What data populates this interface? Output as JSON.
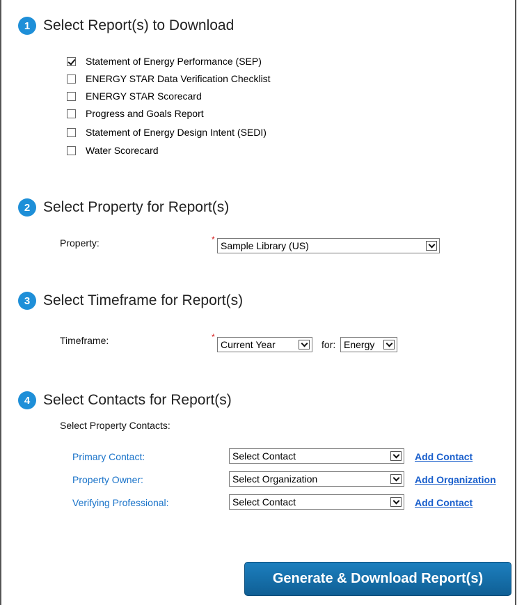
{
  "step1": {
    "number": "1",
    "title": "Select Report(s) to Download",
    "reports": [
      {
        "label": "Statement of Energy Performance (SEP)",
        "checked": true
      },
      {
        "label": "ENERGY STAR Data Verification Checklist",
        "checked": false
      },
      {
        "label": "ENERGY STAR Scorecard",
        "checked": false
      },
      {
        "label": "Progress and Goals Report",
        "checked": false
      },
      {
        "label": "Statement of Energy Design Intent (SEDI)",
        "checked": false
      },
      {
        "label": "Water Scorecard",
        "checked": false
      }
    ]
  },
  "step2": {
    "number": "2",
    "title": "Select Property for Report(s)",
    "property_label": "Property:",
    "required_mark": "*",
    "property_value": "Sample Library (US)"
  },
  "step3": {
    "number": "3",
    "title": "Select Timeframe for Report(s)",
    "timeframe_label": "Timeframe:",
    "required_mark": "*",
    "timeframe_value": "Current Year",
    "for_label": "for:",
    "for_value": "Energy"
  },
  "step4": {
    "number": "4",
    "title": "Select Contacts for Report(s)",
    "subtitle": "Select Property Contacts:",
    "contacts": [
      {
        "label": "Primary Contact:",
        "value": "Select Contact",
        "link": "Add Contact"
      },
      {
        "label": "Property Owner:",
        "value": "Select Organization",
        "link": "Add Organization"
      },
      {
        "label": "Verifying Professional:",
        "value": "Select Contact",
        "link": "Add Contact"
      }
    ]
  },
  "generate_button": "Generate & Download Report(s)",
  "colors": {
    "accent": "#1e8fd8",
    "link": "#1a5fcc",
    "button": "#166fa8",
    "required": "#d41a1a"
  }
}
